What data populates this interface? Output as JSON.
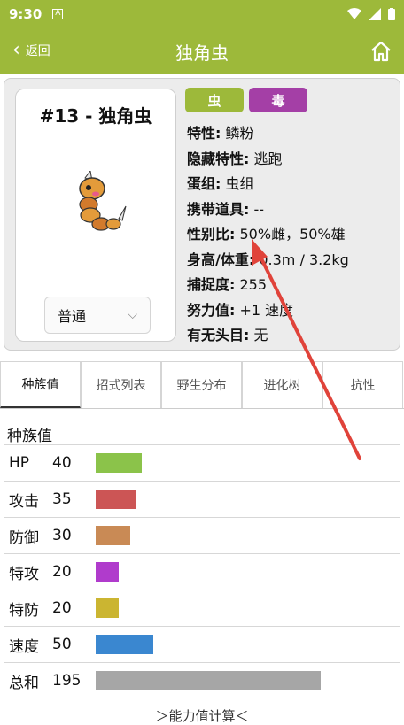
{
  "status": {
    "time": "9:30",
    "notif_icon": "A"
  },
  "appbar": {
    "back_label": "返回",
    "title": "独角虫"
  },
  "pokemon": {
    "name": "#13 - 独角虫",
    "form_select": "普通",
    "types": [
      "虫",
      "毒"
    ],
    "info": [
      {
        "label": "特性:",
        "value": "鳞粉"
      },
      {
        "label": "隐藏特性:",
        "value": "逃跑"
      },
      {
        "label": "蛋组:",
        "value": "虫组"
      },
      {
        "label": "携带道具:",
        "value": "--"
      },
      {
        "label": "性别比:",
        "value": "50%雌，50%雄"
      },
      {
        "label": "身高/体重:",
        "value": "0.3m / 3.2kg"
      },
      {
        "label": "捕捉度:",
        "value": "255"
      },
      {
        "label": "努力值:",
        "value": "+1 速度"
      },
      {
        "label": "有无头目:",
        "value": "无"
      }
    ]
  },
  "tabs": [
    "种族值",
    "招式列表",
    "野生分布",
    "进化树",
    "抗性"
  ],
  "section_title": "种族值",
  "stats": [
    {
      "name": "HP",
      "value": 40,
      "color": "#8bc34a"
    },
    {
      "name": "攻击",
      "value": 35,
      "color": "#cc5555"
    },
    {
      "name": "防御",
      "value": 30,
      "color": "#c98a55"
    },
    {
      "name": "特攻",
      "value": 20,
      "color": "#b03bcc"
    },
    {
      "name": "特防",
      "value": 20,
      "color": "#cbb531"
    },
    {
      "name": "速度",
      "value": 50,
      "color": "#3a87d0"
    },
    {
      "name": "总和",
      "value": 195,
      "color": "#a6a6a6"
    }
  ],
  "footer_link": "＞能力值计算＜"
}
